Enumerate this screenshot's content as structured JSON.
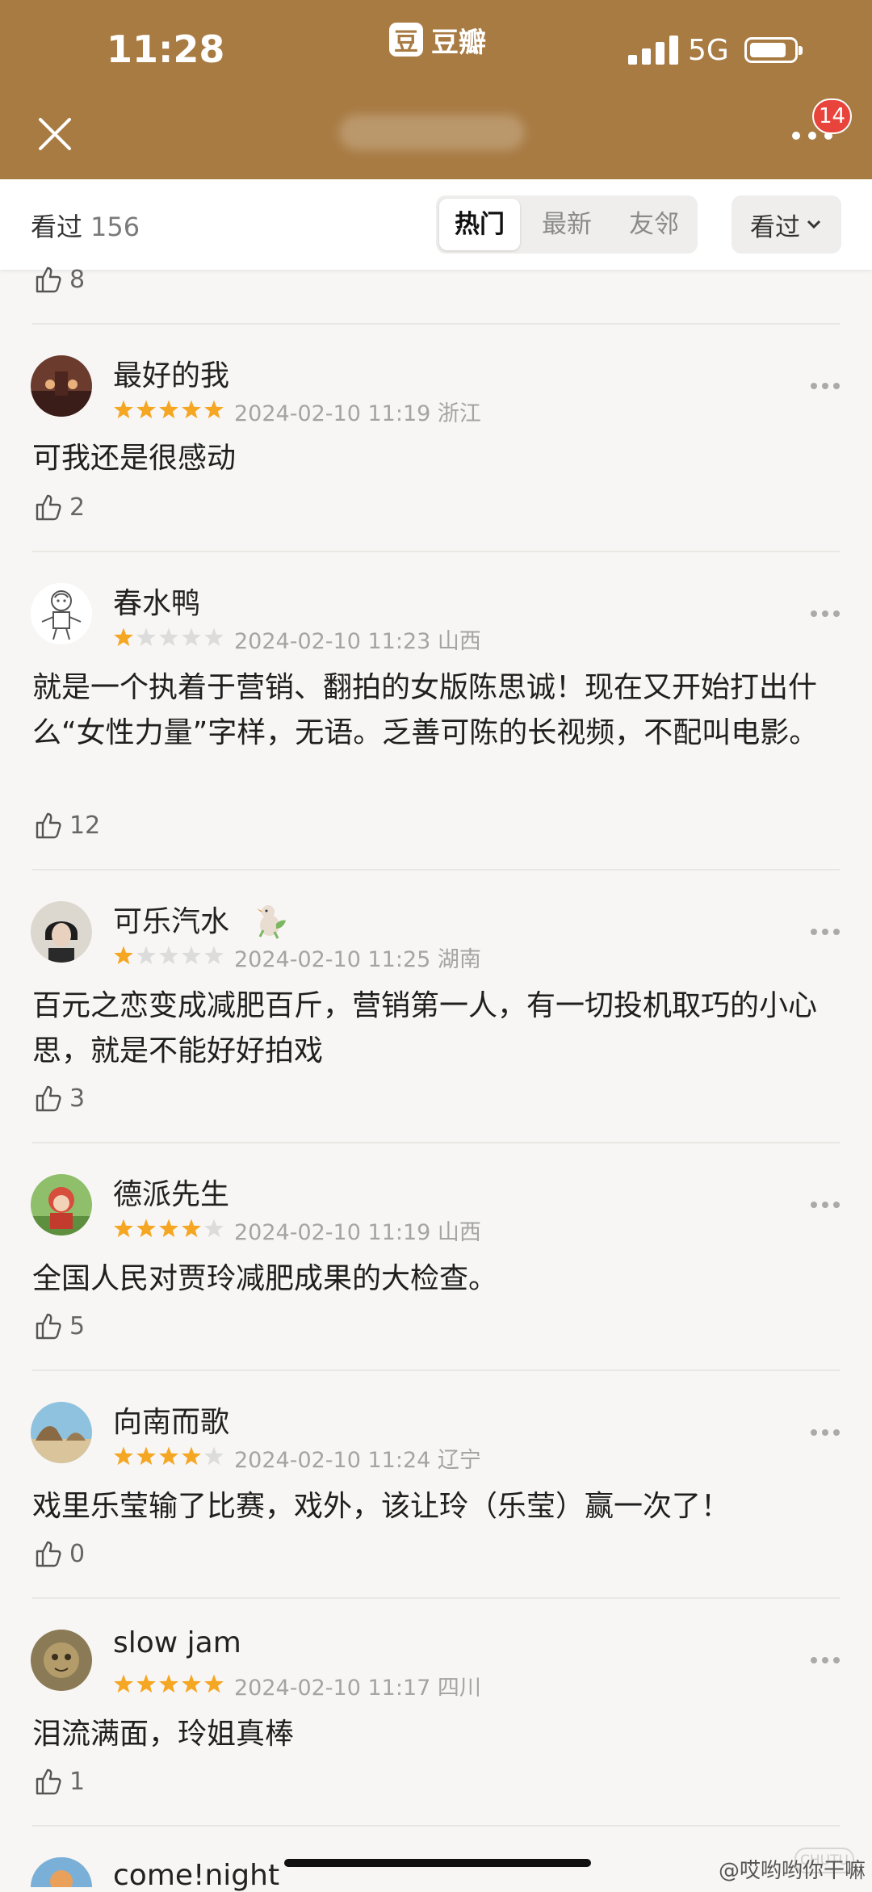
{
  "status": {
    "time": "11:28",
    "app": "豆瓣",
    "app_logo": "豆",
    "network": "5G"
  },
  "header": {
    "notification_count": "14"
  },
  "subbar": {
    "seen_label": "看过",
    "seen_count": "156",
    "tabs": [
      "热门",
      "最新",
      "友邻"
    ],
    "active_tab": "热门",
    "filter_label": "看过"
  },
  "colors": {
    "topbar": "#a87b43",
    "star_on": "#f5a623",
    "star_off": "#dcdcdc",
    "badge": "#e8443b"
  },
  "prev_item": {
    "likes": "8"
  },
  "reviews": [
    {
      "username": "最好的我",
      "rating": 5,
      "date": "2024-02-10 11:19",
      "location": "浙江",
      "text": "可我还是很感动",
      "likes": "2",
      "avatar": "photo-avatar"
    },
    {
      "username": "春水鸭",
      "rating": 1,
      "date": "2024-02-10 11:23",
      "location": "山西",
      "text": "就是一个执着于营销、翻拍的女版陈思诚！现在又开始打出什么“女性力量”字样，无语。乏善可陈的长视频，不配叫电影。",
      "likes": "12",
      "avatar": "sketch-avatar"
    },
    {
      "username": "可乐汽水",
      "rating": 1,
      "date": "2024-02-10 11:25",
      "location": "湖南",
      "text": "百元之恋变成减肥百斤，营销第一人，有一切投机取巧的小心思，就是不能好好拍戏",
      "likes": "3",
      "avatar": "photo-avatar",
      "badge": "bird-badge-icon"
    },
    {
      "username": "德派先生",
      "rating": 4,
      "date": "2024-02-10 11:19",
      "location": "山西",
      "text": "全国人民对贾玲减肥成果的大检查。",
      "likes": "5",
      "avatar": "cartoon-avatar"
    },
    {
      "username": "向南而歌",
      "rating": 4,
      "date": "2024-02-10 11:24",
      "location": "辽宁",
      "text": "戏里乐莹输了比赛，戏外，该让玲（乐莹）赢一次了！",
      "likes": "0",
      "avatar": "beach-avatar"
    },
    {
      "username": "slow jam",
      "rating": 5,
      "date": "2024-02-10 11:17",
      "location": "四川",
      "text": "泪流满面，玲姐真棒",
      "likes": "1",
      "avatar": "photo-avatar"
    }
  ],
  "next_item": {
    "username": "come!night"
  },
  "watermark": {
    "text": "@哎哟哟你干嘛",
    "logo": "CHUTU"
  }
}
